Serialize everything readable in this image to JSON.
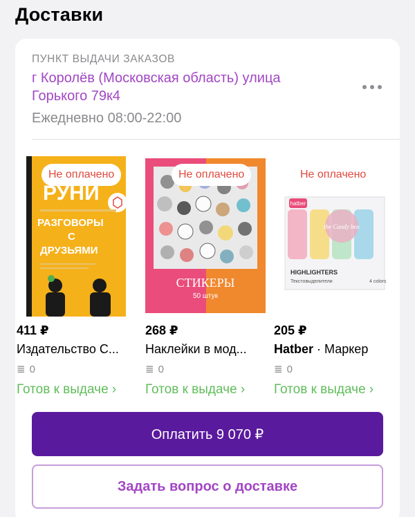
{
  "page": {
    "title": "Доставки"
  },
  "pickup": {
    "label": "ПУНКТ ВЫДАЧИ ЗАКАЗОВ",
    "address": "г Королёв (Московская область) улица Горького 79к4",
    "hours": "Ежедневно 08:00-22:00",
    "more_icon": "more-horizontal-icon"
  },
  "products": [
    {
      "badge": "Не оплачено",
      "price": "411 ₽",
      "name": "Издательство С...",
      "rating_count": "0",
      "status": "Готов к выдаче ›",
      "cover_text": {
        "top": "РУНИ",
        "main": "РАЗГОВОРЫ С ДРУЗЬЯМИ"
      }
    },
    {
      "badge": "Не оплачено",
      "price": "268 ₽",
      "name": "Наклейки в мод...",
      "rating_count": "0",
      "status": "Готов к выдаче ›",
      "cover_text": {
        "main": "СТИКЕРЫ",
        "sub": "50 штук"
      }
    },
    {
      "badge": "Не оплачено",
      "price": "205 ₽",
      "brand": "Hatber",
      "name_sub": " · Маркер",
      "rating_count": "0",
      "status": "Готов к выдаче ›",
      "cover_text": {
        "brand": "hatber",
        "candy": "the Candy box",
        "main": "HIGHLIGHTERS",
        "sub": "Текстовыделители",
        "colors": "4 colors"
      }
    }
  ],
  "actions": {
    "pay_label": "Оплатить 9 070 ₽",
    "ask_label": "Задать вопрос о доставке"
  },
  "colors": {
    "accent_purple": "#a246c4",
    "pay_button": "#5a1a9e",
    "status_green": "#5fbd5a",
    "badge_red": "#e0483d"
  }
}
